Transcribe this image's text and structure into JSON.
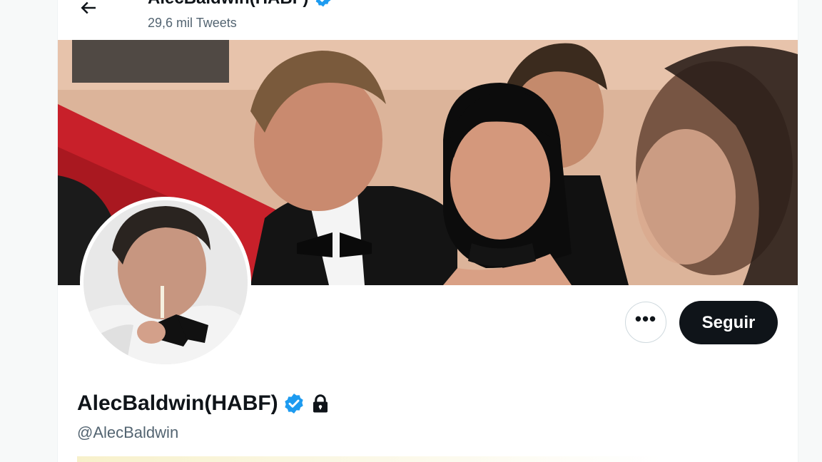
{
  "header": {
    "back_icon": "arrow-left-icon",
    "name": "AlecBaldwin(HABF)",
    "tweet_count": "29,6 mil Tweets"
  },
  "banner": {
    "description_icon": "banner-photo"
  },
  "avatar": {
    "icon": "profile-photo"
  },
  "actions": {
    "more_label": "•••",
    "follow_label": "Seguir"
  },
  "profile": {
    "name": "AlecBaldwin(HABF)",
    "handle": "@AlecBaldwin",
    "verified_icon": "verified-badge-icon",
    "protected_icon": "lock-icon"
  },
  "colors": {
    "verified": "#1d9bf0",
    "follow_bg": "#0f1419",
    "muted_text": "#536471"
  }
}
